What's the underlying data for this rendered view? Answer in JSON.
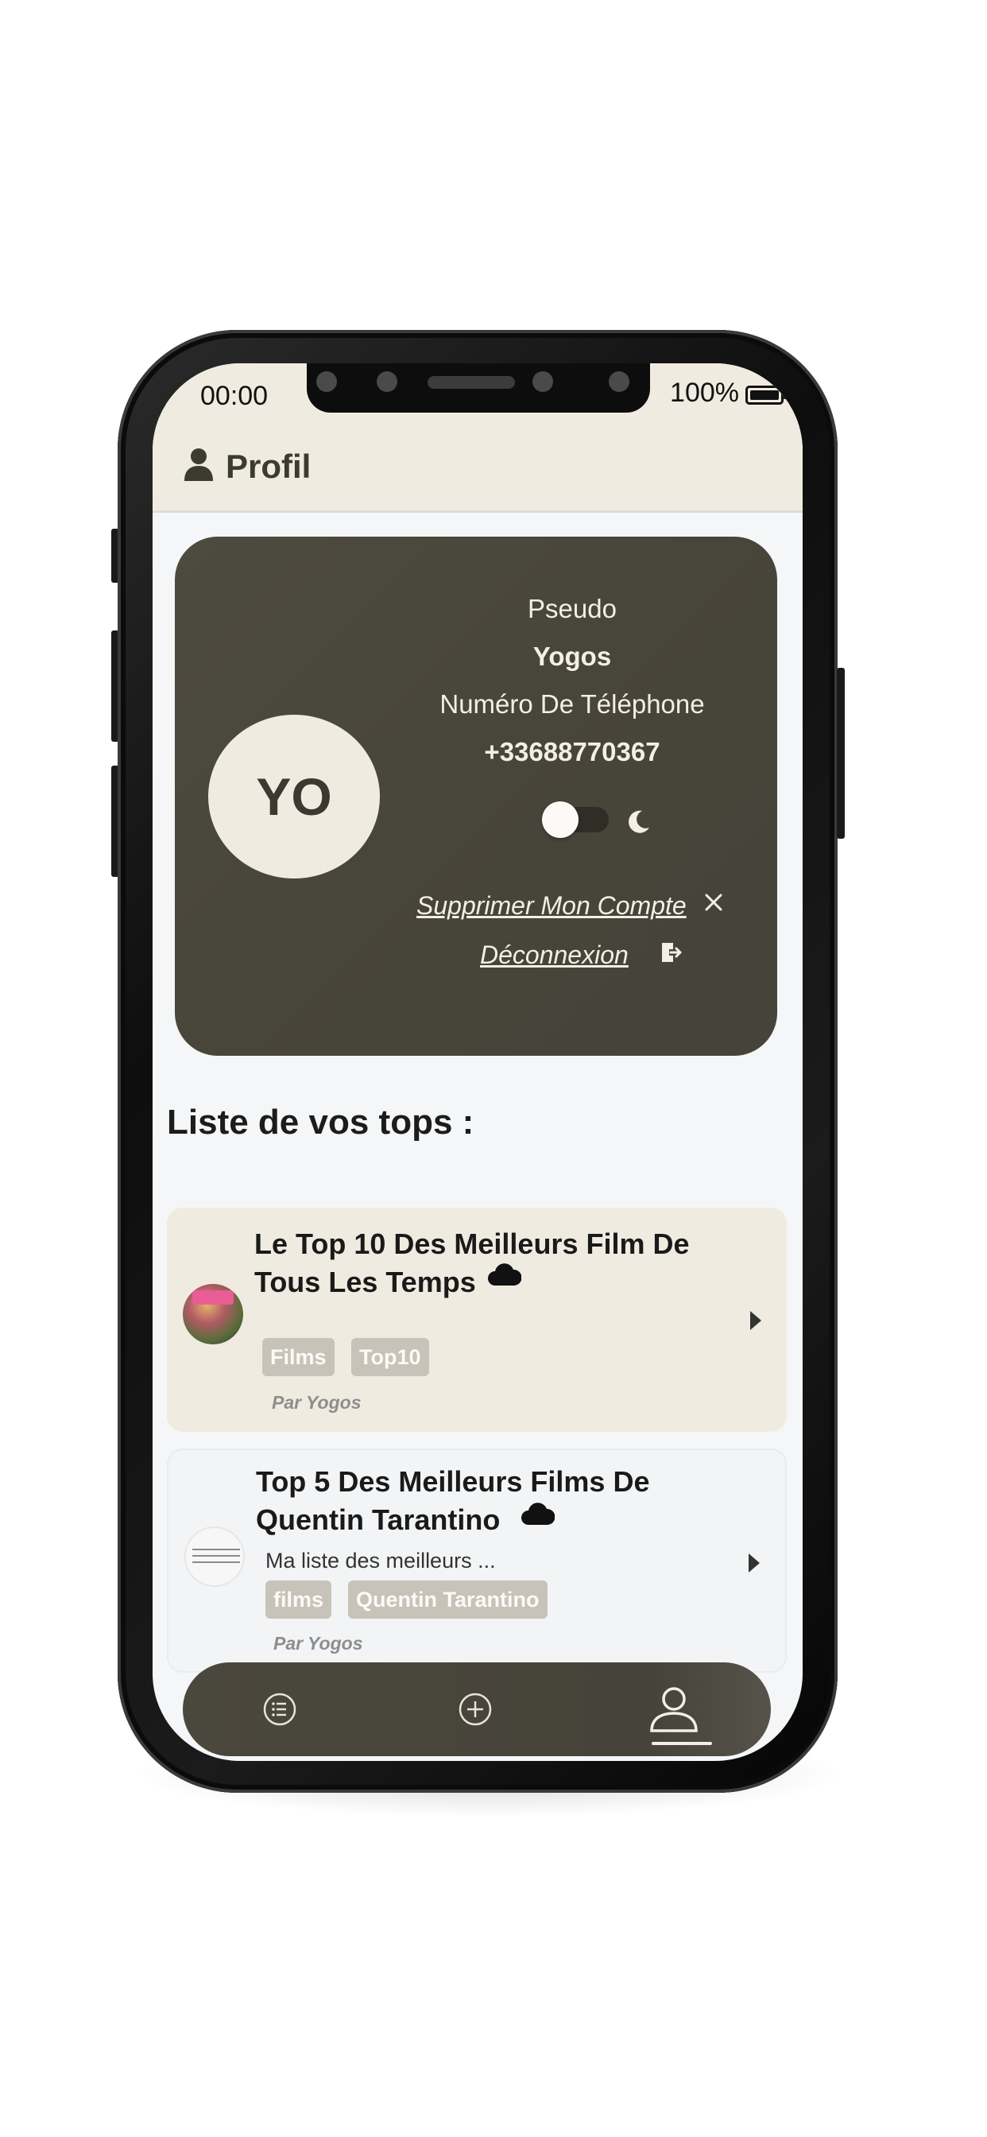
{
  "status_bar": {
    "time": "00:00",
    "battery": "100%"
  },
  "header": {
    "title": "Profil",
    "icon": "user-icon"
  },
  "profile": {
    "avatar_initials": "YO",
    "pseudo_label": "Pseudo",
    "pseudo_value": "Yogos",
    "phone_label": "Numéro De Téléphone",
    "phone_value": "+33688770367",
    "dark_mode_toggle": "off",
    "delete_account_label": "Supprimer Mon Compte ",
    "logout_label": "Déconnexion "
  },
  "tops": {
    "section_title": "Liste de vos tops :",
    "items": [
      {
        "title": "Le Top 10 Des Meilleurs Film De Tous Les Temps",
        "description": "",
        "tags": [
          "Films",
          "Top10"
        ],
        "author": "Par Yogos",
        "icon": "cloud-icon"
      },
      {
        "title": "Top 5 Des Meilleurs Films De Quentin Tarantino",
        "description": "Ma liste des meilleurs ...",
        "tags": [
          "films",
          "Quentin Tarantino"
        ],
        "author": "Par Yogos",
        "icon": "cloud-icon"
      }
    ]
  },
  "bottom_nav": {
    "items": [
      "list-icon",
      "add-icon",
      "profile-icon"
    ],
    "active": "profile-icon"
  },
  "colors": {
    "card_dark": "#4a473c",
    "header_bg": "#f0ebe0",
    "tag_bg": "#c8c3b8",
    "card_text": "#f3efe4"
  }
}
